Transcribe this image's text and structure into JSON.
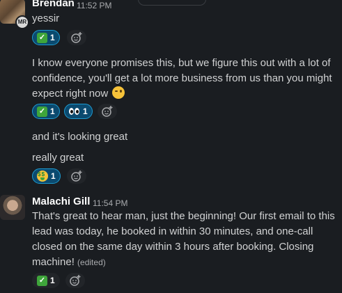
{
  "messages": [
    {
      "author": "Brendan",
      "time": "11:52 PM",
      "avatar_badge": "MR",
      "lines": [
        "yessir"
      ]
    },
    {
      "text": "I know everyone promises this, but we figure this out with a lot of confidence, you'll get a lot more business from us than you might expect right now",
      "emoji": "wink-icon"
    },
    {
      "text": "and it's looking great"
    },
    {
      "text": "really great"
    },
    {
      "author": "Malachi Gill",
      "time": "11:54 PM",
      "text": "That's great to hear man, just the beginning! Our first email to this lead was today, he booked in within 30 minutes, and one-call closed on the same day within 3 hours after booking. Closing machine!",
      "edited": "(edited)"
    }
  ],
  "reactions": {
    "r1": {
      "icon": "white-check-mark",
      "count": "1"
    },
    "r2": {
      "icon": "white-check-mark",
      "count": "1"
    },
    "r3": {
      "icon": "eyes",
      "count": "1"
    },
    "r4": {
      "icon": "money-mouth-face",
      "count": "1"
    },
    "r5": {
      "icon": "white-check-mark",
      "count": "1"
    }
  },
  "colors": {
    "background": "#1a1d21",
    "reaction_active_bg": "#0b4a6f",
    "reaction_active_border": "#1d9bd1",
    "text": "#d1d2d3",
    "muted": "#a9abae"
  }
}
